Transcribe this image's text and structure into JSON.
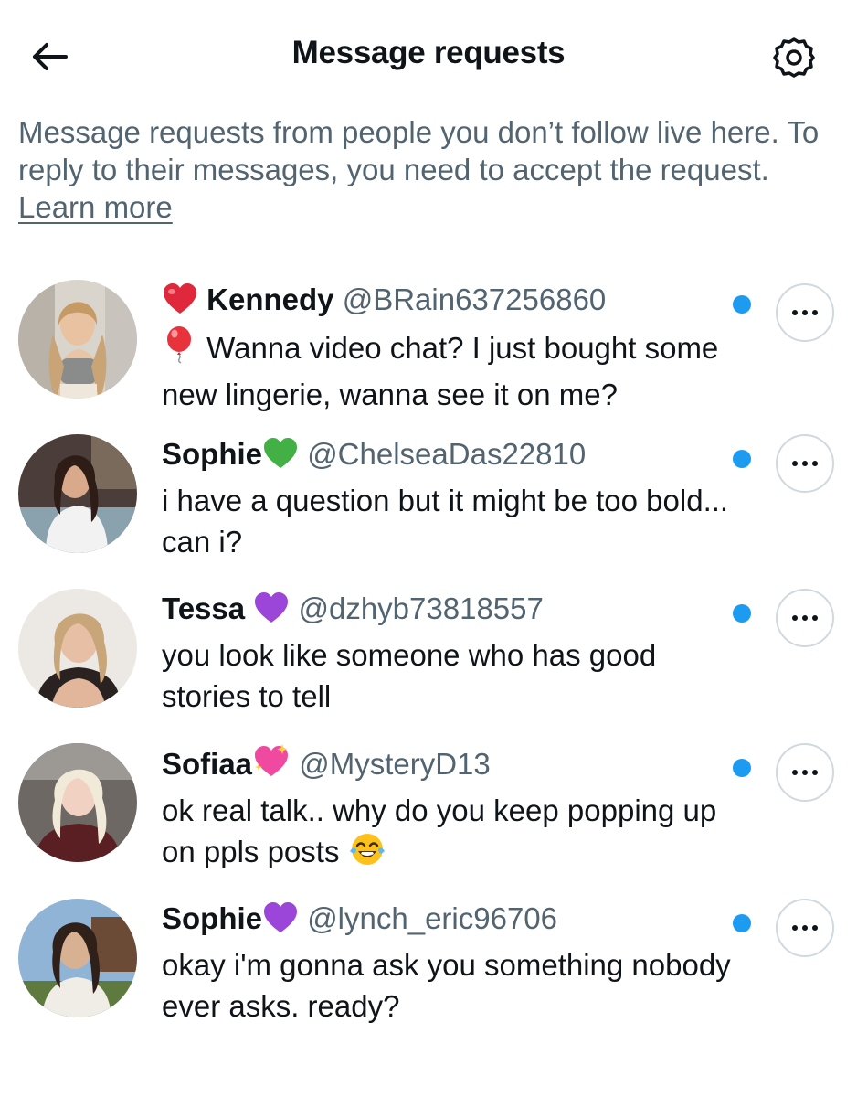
{
  "header": {
    "title": "Message requests",
    "back_icon": "arrow-left-icon",
    "settings_icon": "gear-icon"
  },
  "intro": {
    "text": "Message requests from people you don’t follow live here. To reply to their messages, you need to accept the request.",
    "learn_more": "Learn more"
  },
  "requests": [
    {
      "name": "Kennedy",
      "name_prefix_icon": "red-heart-emoji",
      "handle": "@BRain637256860",
      "message_prefix_icon": "red-balloon-emoji",
      "message": "Wanna video chat? I just bought some new lingerie, wanna see it on me?",
      "unread": true
    },
    {
      "name": "Sophie",
      "name_suffix_icon": "green-heart-emoji",
      "handle": "@ChelseaDas22810",
      "message": "i have a question but it might be too bold... can i?",
      "unread": true
    },
    {
      "name": "Tessa",
      "name_suffix_icon": "purple-heart-emoji",
      "handle": "@dzhyb73818557",
      "message": "you look like someone who has good stories to tell",
      "unread": true
    },
    {
      "name": "Sofiaa",
      "name_suffix_icon": "sparkling-heart-emoji",
      "handle": "@MysteryD13",
      "message": "ok real talk.. why do you keep popping up on ppls posts",
      "message_suffix_icon": "tears-of-joy-emoji",
      "unread": true
    },
    {
      "name": "Sophie",
      "name_suffix_icon": "purple-heart-emoji",
      "handle": "@lynch_eric96706",
      "message": "okay i'm gonna ask you something nobody ever asks. ready?",
      "unread": true
    }
  ],
  "colors": {
    "accent": "#1d9bf0",
    "secondary_text": "#536471",
    "primary_text": "#0f1419",
    "border": "#cfd9de"
  }
}
